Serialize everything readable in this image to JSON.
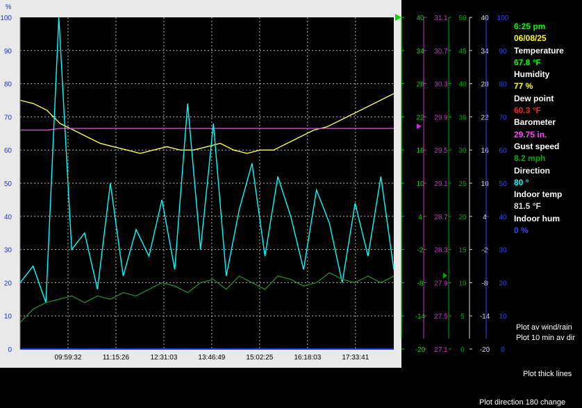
{
  "chart_data": {
    "type": "line",
    "x_ticks": [
      "09:59:32",
      "11:15:26",
      "12:31:03",
      "13:46:49",
      "15:02:25",
      "16:18:03",
      "17:33:41"
    ],
    "left_axis": {
      "unit": "%",
      "ticks": [
        "100",
        "90",
        "80",
        "70",
        "60",
        "50",
        "40",
        "30",
        "20",
        "10",
        "0"
      ]
    },
    "right_axes": [
      {
        "name": "temperature",
        "color": "#00dd00",
        "ticks": [
          "40",
          "34",
          "28",
          "22",
          "16",
          "10",
          "4",
          "-2",
          "-8",
          "-14",
          "-20"
        ]
      },
      {
        "name": "barometer",
        "color": "#cc33cc",
        "ticks": [
          "31.1",
          "30.7",
          "30.3",
          "29.9",
          "29.5",
          "29.1",
          "28.7",
          "28.3",
          "27.9",
          "27.5",
          "27.1"
        ]
      },
      {
        "name": "wind",
        "color": "#00aa00",
        "ticks": [
          "50",
          "45",
          "40",
          "35",
          "30",
          "25",
          "20",
          "15",
          "10",
          "5",
          "0"
        ]
      },
      {
        "name": "gray",
        "color": "#dddddd",
        "ticks": [
          "40",
          "34",
          "28",
          "22",
          "16",
          "10",
          "4",
          "-2",
          "-8",
          "-14",
          "-20"
        ]
      },
      {
        "name": "blue",
        "color": "#3344ff",
        "ticks": [
          "100",
          "90",
          "80",
          "70",
          "60",
          "50",
          "40",
          "30",
          "20",
          "10",
          "0"
        ]
      }
    ],
    "series": [
      {
        "color": "#ffff44",
        "axis": "percent",
        "values": [
          75,
          74,
          72,
          68,
          66,
          64,
          62,
          61,
          60,
          59,
          60,
          61,
          60,
          60,
          61,
          62,
          60,
          59,
          60,
          60,
          62,
          64,
          66,
          67,
          69,
          71,
          73,
          75,
          77
        ]
      },
      {
        "color": "#dd44dd",
        "axis": "percent",
        "values": [
          66,
          66,
          66,
          66.5,
          66.5,
          66.5,
          66.5,
          66.5,
          66.5,
          66.5,
          66.5,
          66.5,
          66.5,
          66.5,
          66.5,
          66.5,
          66.5,
          66.5,
          66.5,
          66.5,
          66.5,
          66.5,
          66.5,
          66.5,
          66.5,
          66.5,
          66.5,
          66.5,
          66.5
        ]
      },
      {
        "color": "#00ffff",
        "axis": "percent",
        "values": [
          20,
          25,
          14,
          100,
          30,
          35,
          18,
          50,
          22,
          36,
          28,
          45,
          24,
          74,
          30,
          68,
          22,
          42,
          56,
          28,
          52,
          40,
          24,
          48,
          38,
          20,
          44,
          28,
          52,
          24
        ]
      },
      {
        "color": "#228822",
        "axis": "percent",
        "values": [
          8,
          12,
          14,
          15,
          16,
          14,
          16,
          15,
          17,
          16,
          18,
          20,
          19,
          17,
          20,
          21,
          18,
          22,
          20,
          18,
          22,
          21,
          19,
          20,
          23,
          21,
          20,
          22,
          20,
          22
        ]
      }
    ]
  },
  "readout": {
    "time": "6:25 pm",
    "date": "06/08/25",
    "temperature_label": "Temperature",
    "temperature_value": "67.8 °F",
    "humidity_label": "Humidity",
    "humidity_value": "77 %",
    "dewpoint_label": "Dew point",
    "dewpoint_value": "60.3 °F",
    "barometer_label": "Barometer",
    "barometer_value": "29.75 in.",
    "gust_label": "Gust speed",
    "gust_value": "8.2 mph",
    "direction_label": "Direction",
    "direction_value": "80 °",
    "indoor_temp_label": "Indoor temp",
    "indoor_temp_value": "81.5 °F",
    "indoor_hum_label": "Indoor hum",
    "indoor_hum_value": "0 %"
  },
  "options": {
    "plot_av_wind": "Plot av wind/rain",
    "plot_10min": "Plot 10 min av dir",
    "plot_thick": "Plot thick lines",
    "plot_direction": "Plot direction 180 change"
  },
  "colors": {
    "time": "#00ff00",
    "date": "#ffff00",
    "temperature": "#00ff00",
    "humidity": "#ffff00",
    "dewpoint": "#ff2222",
    "barometer": "#ff44ff",
    "gust": "#00aa00",
    "direction": "#00ffff",
    "indoor_temp": "#dddddd",
    "indoor_hum": "#3344ff"
  }
}
